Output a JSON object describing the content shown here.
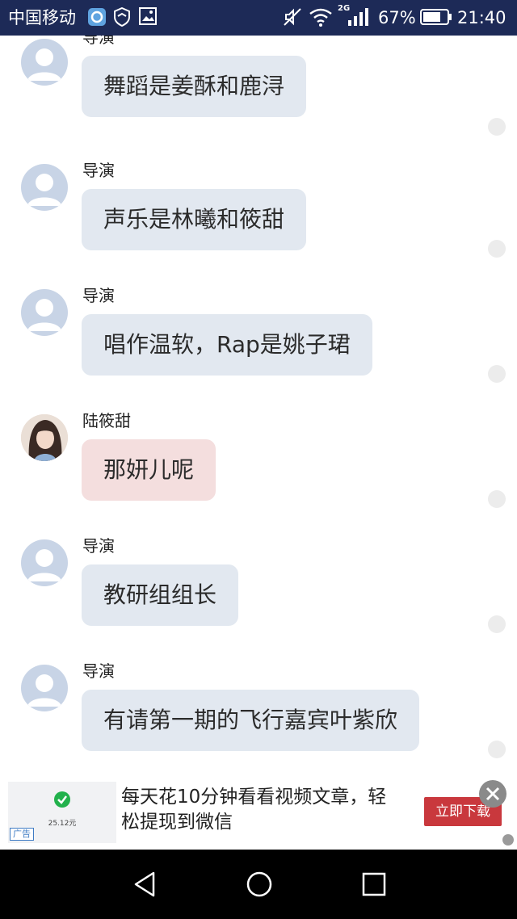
{
  "status_bar": {
    "carrier": "中国移动",
    "network_badge": "2G",
    "battery_percent": "67%",
    "time": "21:40",
    "icons": [
      "app-notification-icon",
      "shield-icon",
      "image-icon",
      "mute-icon",
      "wifi-icon",
      "signal-icon",
      "battery-icon"
    ]
  },
  "chat": {
    "messages": [
      {
        "sender": "导演",
        "text": "舞蹈是姜酥和鹿浔",
        "avatar": "default-avatar"
      },
      {
        "sender": "导演",
        "text": "声乐是林曦和筱甜",
        "avatar": "default-avatar"
      },
      {
        "sender": "导演",
        "text": "唱作温软，Rap是姚子珺",
        "avatar": "default-avatar"
      },
      {
        "sender": "陆筱甜",
        "text": "那妍儿呢",
        "avatar": "photo-avatar"
      },
      {
        "sender": "导演",
        "text": "教研组组长",
        "avatar": "default-avatar"
      },
      {
        "sender": "导演",
        "text": "有请第一期的飞行嘉宾叶紫欣",
        "avatar": "default-avatar"
      }
    ]
  },
  "ad": {
    "tag": "广告",
    "thumb_amount": "25.12元",
    "text": "每天花10分钟看看视频文章，轻松提现到微信",
    "button_label": "立即下载"
  },
  "colors": {
    "status_bar_bg": "#1d2a57",
    "bubble_default": "#e2e8f0",
    "bubble_highlight": "#f4dede",
    "ad_button": "#c9383d"
  }
}
